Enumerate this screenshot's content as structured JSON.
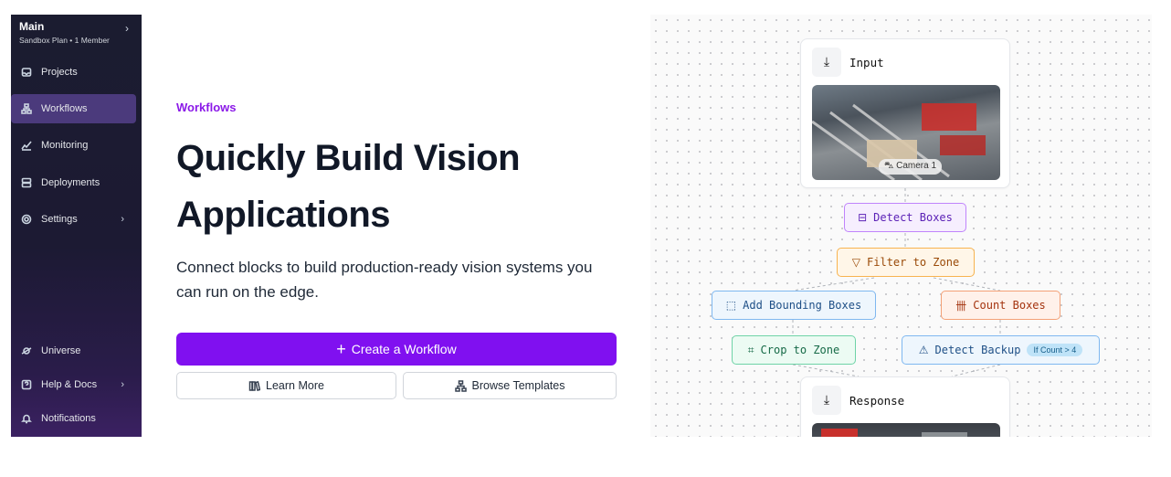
{
  "sidebar": {
    "workspace": {
      "name": "Main",
      "subtitle": "Sandbox Plan • 1 Member"
    },
    "items": [
      {
        "label": "Projects",
        "icon": "inbox-icon"
      },
      {
        "label": "Workflows",
        "icon": "workflow-icon",
        "active": true
      },
      {
        "label": "Monitoring",
        "icon": "chart-icon"
      },
      {
        "label": "Deployments",
        "icon": "server-icon"
      },
      {
        "label": "Settings",
        "icon": "gear-icon",
        "has_submenu": true
      }
    ],
    "bottom_items": [
      {
        "label": "Universe",
        "icon": "planet-icon"
      },
      {
        "label": "Help & Docs",
        "icon": "help-icon",
        "has_submenu": true
      },
      {
        "label": "Notifications",
        "icon": "bell-icon"
      }
    ]
  },
  "hero": {
    "eyebrow": "Workflows",
    "title_line1": "Quickly Build Vision",
    "title_line2": "Applications",
    "description": "Connect blocks to build production-ready vision systems you can run on the edge.",
    "primary_button": "Create a Workflow",
    "learn_more_button": "Learn More",
    "browse_button": "Browse Templates"
  },
  "diagram": {
    "input_card": {
      "title": "Input",
      "camera_tag": "Camera 1"
    },
    "nodes": {
      "detect_boxes": "Detect Boxes",
      "filter_zone": "Filter to Zone",
      "add_bounding": "Add Bounding Boxes",
      "count_boxes": "Count Boxes",
      "crop_zone": "Crop to Zone",
      "detect_backup": "Detect Backup",
      "detect_backup_badge": "If Count > 4"
    },
    "response_card": {
      "title": "Response"
    }
  },
  "colors": {
    "accent": "#8010f0",
    "eyebrow": "#8b19e8",
    "sidebar_bg": "#1b1c30",
    "purple_node": "#a855f7",
    "orange_node": "#f59e0b",
    "blue_node": "#60a5fa",
    "red_node": "#f97316",
    "green_node": "#34d399"
  }
}
